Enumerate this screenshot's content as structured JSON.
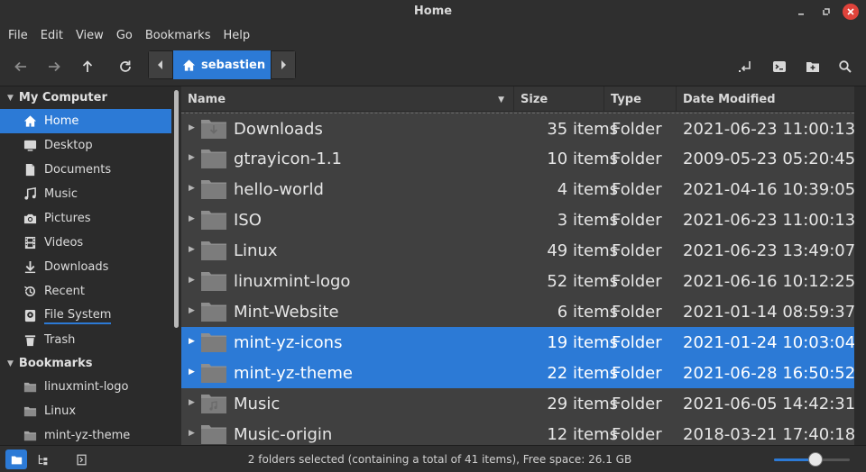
{
  "window": {
    "title": "Home"
  },
  "menu": [
    "File",
    "Edit",
    "View",
    "Go",
    "Bookmarks",
    "Help"
  ],
  "toolbar": {
    "location": "sebastien"
  },
  "sidebar": {
    "sections": [
      {
        "title": "My Computer",
        "items": [
          {
            "label": "Home",
            "icon": "home-icon",
            "active": true
          },
          {
            "label": "Desktop",
            "icon": "desktop-icon"
          },
          {
            "label": "Documents",
            "icon": "document-icon"
          },
          {
            "label": "Music",
            "icon": "music-icon"
          },
          {
            "label": "Pictures",
            "icon": "camera-icon"
          },
          {
            "label": "Videos",
            "icon": "video-icon"
          },
          {
            "label": "Downloads",
            "icon": "download-icon"
          },
          {
            "label": "Recent",
            "icon": "recent-icon"
          },
          {
            "label": "File System",
            "icon": "drive-icon"
          },
          {
            "label": "Trash",
            "icon": "trash-icon"
          }
        ]
      },
      {
        "title": "Bookmarks",
        "items": [
          {
            "label": "linuxmint-logo",
            "icon": "folder-icon"
          },
          {
            "label": "Linux",
            "icon": "folder-icon"
          },
          {
            "label": "mint-yz-theme",
            "icon": "folder-icon"
          }
        ]
      }
    ]
  },
  "columns": {
    "name": "Name",
    "size": "Size",
    "type": "Type",
    "date": "Date Modified"
  },
  "files": [
    {
      "name": "Downloads",
      "size": "35 items",
      "type": "Folder",
      "date": "2021-06-23 11:00:13",
      "emblem": "download",
      "selected": false
    },
    {
      "name": "gtrayicon-1.1",
      "size": "10 items",
      "type": "Folder",
      "date": "2009-05-23 05:20:45",
      "emblem": "",
      "selected": false
    },
    {
      "name": "hello-world",
      "size": "4 items",
      "type": "Folder",
      "date": "2021-04-16 10:39:05",
      "emblem": "",
      "selected": false
    },
    {
      "name": "ISO",
      "size": "3 items",
      "type": "Folder",
      "date": "2021-06-23 11:00:13",
      "emblem": "",
      "selected": false
    },
    {
      "name": "Linux",
      "size": "49 items",
      "type": "Folder",
      "date": "2021-06-23 13:49:07",
      "emblem": "",
      "selected": false
    },
    {
      "name": "linuxmint-logo",
      "size": "52 items",
      "type": "Folder",
      "date": "2021-06-16 10:12:25",
      "emblem": "",
      "selected": false
    },
    {
      "name": "Mint-Website",
      "size": "6 items",
      "type": "Folder",
      "date": "2021-01-14 08:59:37",
      "emblem": "",
      "selected": false
    },
    {
      "name": "mint-yz-icons",
      "size": "19 items",
      "type": "Folder",
      "date": "2021-01-24 10:03:04",
      "emblem": "",
      "selected": true
    },
    {
      "name": "mint-yz-theme",
      "size": "22 items",
      "type": "Folder",
      "date": "2021-06-28 16:50:52",
      "emblem": "",
      "selected": true
    },
    {
      "name": "Music",
      "size": "29 items",
      "type": "Folder",
      "date": "2021-06-05 14:42:31",
      "emblem": "music",
      "selected": false
    },
    {
      "name": "Music-origin",
      "size": "12 items",
      "type": "Folder",
      "date": "2018-03-21 17:40:18",
      "emblem": "",
      "selected": false
    }
  ],
  "status": {
    "text": "2 folders selected (containing a total of 41 items), Free space: 26.1 GB",
    "zoom_level": 0.55
  },
  "colors": {
    "accent": "#2c7ad6",
    "list_bg": "#404040",
    "chrome_bg": "#2f2f2f"
  }
}
